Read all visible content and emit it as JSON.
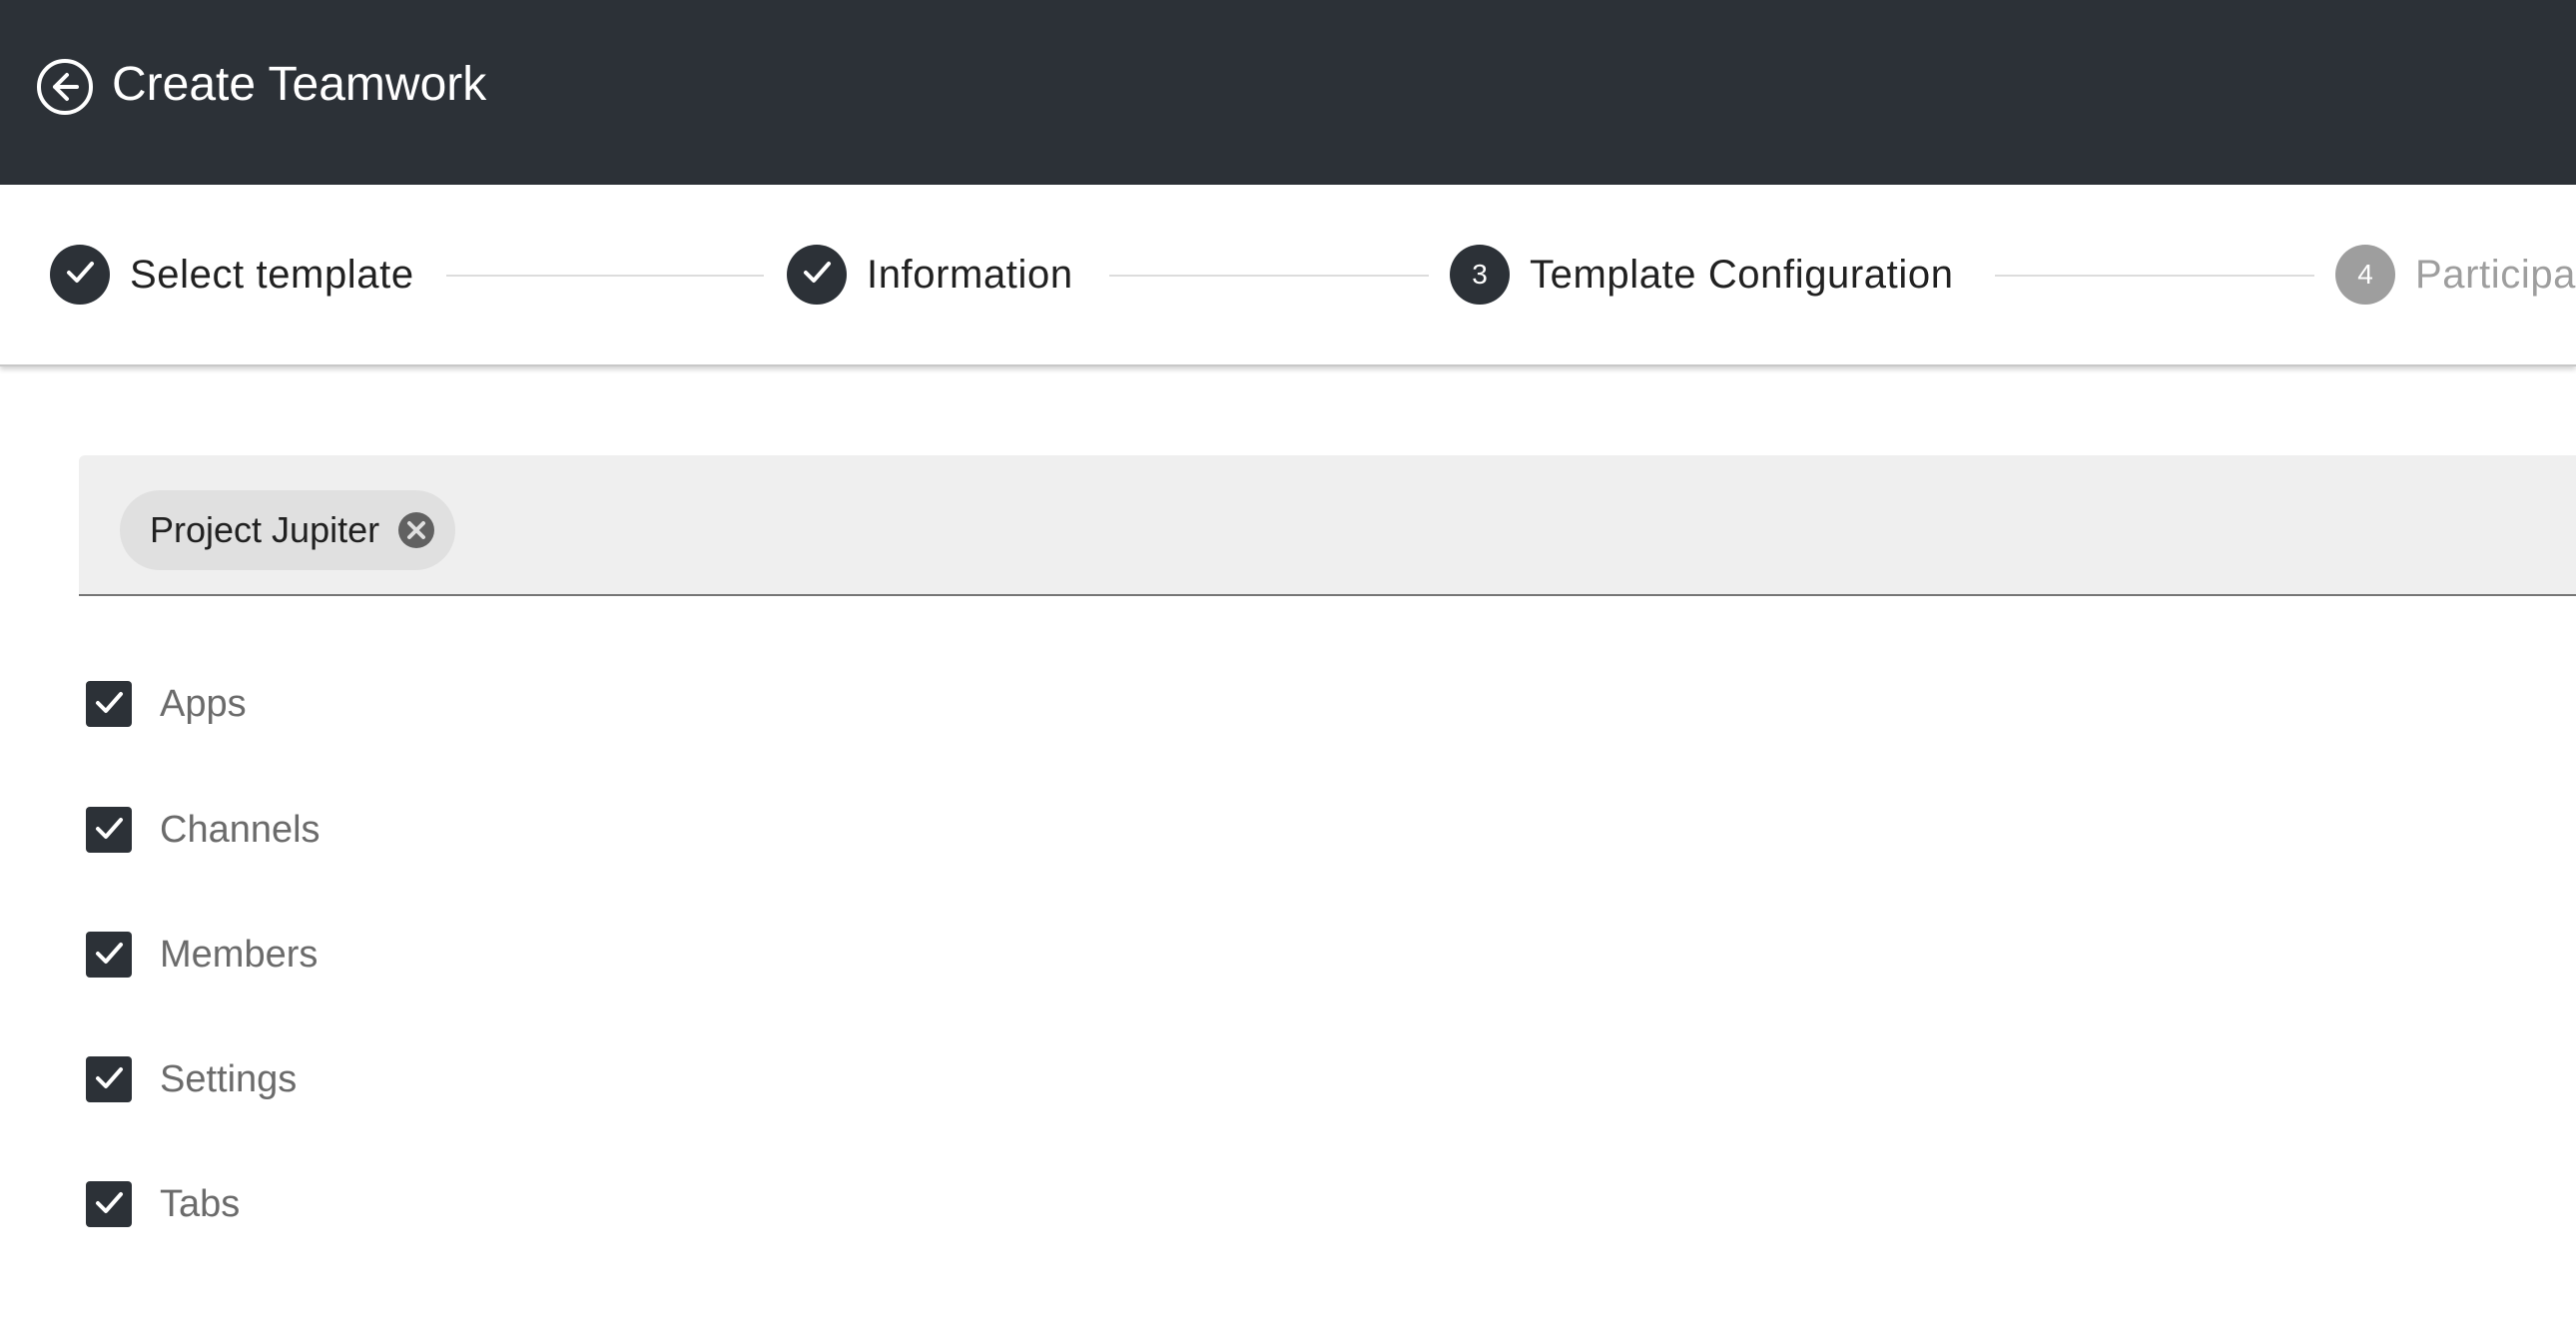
{
  "header": {
    "title": "Create Teamwork",
    "back_icon": "arrow-left-circle-icon"
  },
  "stepper": {
    "steps": [
      {
        "label": "Select template",
        "state": "completed",
        "icon": "check-icon"
      },
      {
        "label": "Information",
        "state": "completed",
        "icon": "check-icon"
      },
      {
        "label": "Template Configuration",
        "state": "active",
        "number": "3"
      },
      {
        "label": "Participants",
        "state": "inactive",
        "number": "4"
      }
    ]
  },
  "template_chips": [
    {
      "label": "Project Jupiter",
      "remove_icon": "cancel-circle-icon"
    }
  ],
  "options": [
    {
      "label": "Apps",
      "checked": true
    },
    {
      "label": "Channels",
      "checked": true
    },
    {
      "label": "Members",
      "checked": true
    },
    {
      "label": "Settings",
      "checked": true
    },
    {
      "label": "Tabs",
      "checked": true
    }
  ],
  "colors": {
    "header_bg": "#2c3137",
    "accent": "#2c3137",
    "inactive": "#9e9e9e",
    "field_bg": "#efefef"
  }
}
